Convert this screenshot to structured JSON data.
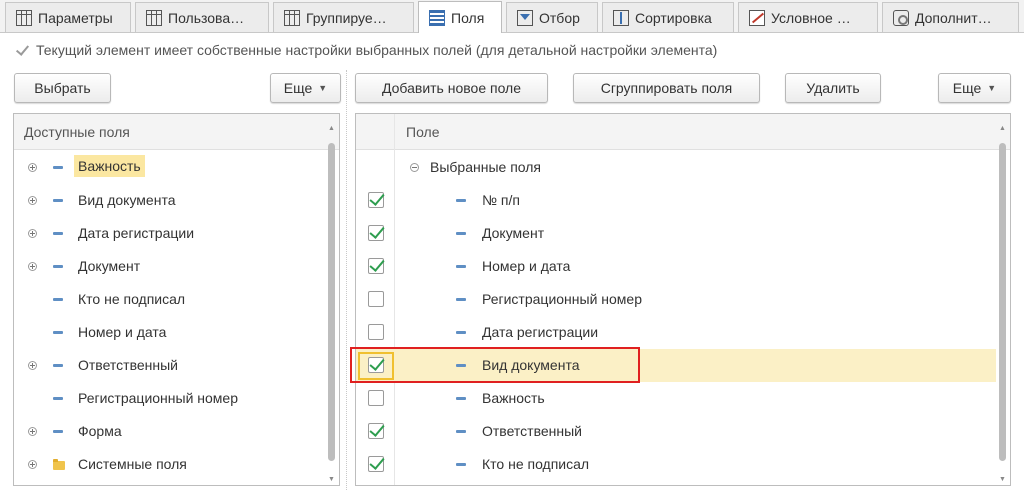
{
  "tabs": [
    {
      "label": "Параметры",
      "icon": "table-icon"
    },
    {
      "label": "Пользова…",
      "icon": "table-icon"
    },
    {
      "label": "Группируе…",
      "icon": "table-icon"
    },
    {
      "label": "Поля",
      "icon": "fields-icon",
      "active": true
    },
    {
      "label": "Отбор",
      "icon": "filter-icon"
    },
    {
      "label": "Сортировка",
      "icon": "sort-icon"
    },
    {
      "label": "Условное …",
      "icon": "conditional-format-icon"
    },
    {
      "label": "Дополнит…",
      "icon": "settings-icon"
    }
  ],
  "own_settings": {
    "label": "Текущий элемент имеет собственные настройки выбранных полей (для детальной настройки элемента)",
    "checked": true
  },
  "left_toolbar": {
    "select_label": "Выбрать",
    "more_label": "Еще"
  },
  "right_toolbar": {
    "add_label": "Добавить новое поле",
    "group_label": "Сгруппировать поля",
    "delete_label": "Удалить",
    "more_label": "Еще"
  },
  "available_fields": {
    "header": "Доступные поля",
    "items": [
      {
        "label": "Важность",
        "expandable": true,
        "icon": "field-icon",
        "highlighted": true
      },
      {
        "label": "Вид документа",
        "expandable": true,
        "icon": "field-icon"
      },
      {
        "label": "Дата регистрации",
        "expandable": true,
        "icon": "field-icon"
      },
      {
        "label": "Документ",
        "expandable": true,
        "icon": "field-icon"
      },
      {
        "label": "Кто не подписал",
        "expandable": false,
        "icon": "field-icon"
      },
      {
        "label": "Номер и дата",
        "expandable": false,
        "icon": "field-icon"
      },
      {
        "label": "Ответственный",
        "expandable": true,
        "icon": "field-icon"
      },
      {
        "label": "Регистрационный номер",
        "expandable": false,
        "icon": "field-icon"
      },
      {
        "label": "Форма",
        "expandable": true,
        "icon": "field-icon"
      },
      {
        "label": "Системные поля",
        "expandable": true,
        "icon": "folder-icon"
      }
    ]
  },
  "selected_fields": {
    "header": "Поле",
    "group_label": "Выбранные поля",
    "items": [
      {
        "label": "№ п/п",
        "checked": true
      },
      {
        "label": "Документ",
        "checked": true
      },
      {
        "label": "Номер и дата",
        "checked": true
      },
      {
        "label": "Регистрационный номер",
        "checked": false
      },
      {
        "label": "Дата регистрации",
        "checked": false
      },
      {
        "label": "Вид документа",
        "checked": true,
        "selected": true
      },
      {
        "label": "Важность",
        "checked": false
      },
      {
        "label": "Ответственный",
        "checked": true
      },
      {
        "label": "Кто не подписал",
        "checked": true
      }
    ]
  },
  "colors": {
    "selected_row": "#fbf0c6",
    "highlight_label": "#fbe7a1",
    "check_green": "#2e9e4f",
    "annotation_red": "#e02020"
  }
}
